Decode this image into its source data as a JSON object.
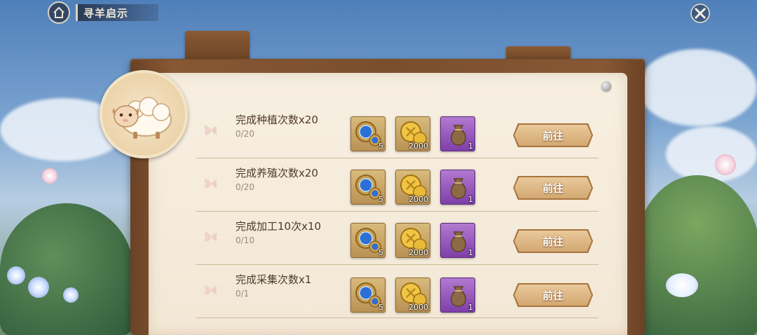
{
  "header": {
    "title": "寻羊启示"
  },
  "icons": {
    "home": "home-icon",
    "close": "close-icon",
    "gem": "blue-gem-icon",
    "coin": "gold-coin-icon",
    "bag": "seed-bag-icon",
    "butterfly": "butterfly-icon",
    "sheep": "sheep-icon"
  },
  "colors": {
    "board": "#7a4e2d",
    "paper": "#f3e8d6",
    "button": "#d3a872",
    "purple_reward": "#7e3fa8"
  },
  "tasks": [
    {
      "title": "完成种植次数x20",
      "progress": "0/20",
      "rewards": [
        {
          "type": "gem",
          "count": "5"
        },
        {
          "type": "coin",
          "count": "2000"
        },
        {
          "type": "bag",
          "count": "1"
        }
      ],
      "button": "前往"
    },
    {
      "title": "完成养殖次数x20",
      "progress": "0/20",
      "rewards": [
        {
          "type": "gem",
          "count": "5"
        },
        {
          "type": "coin",
          "count": "2000"
        },
        {
          "type": "bag",
          "count": "1"
        }
      ],
      "button": "前往"
    },
    {
      "title": "完成加工10次x10",
      "progress": "0/10",
      "rewards": [
        {
          "type": "gem",
          "count": "5"
        },
        {
          "type": "coin",
          "count": "2000"
        },
        {
          "type": "bag",
          "count": "1"
        }
      ],
      "button": "前往"
    },
    {
      "title": "完成采集次数x1",
      "progress": "0/1",
      "rewards": [
        {
          "type": "gem",
          "count": "5"
        },
        {
          "type": "coin",
          "count": "2000"
        },
        {
          "type": "bag",
          "count": "1"
        }
      ],
      "button": "前往"
    }
  ]
}
